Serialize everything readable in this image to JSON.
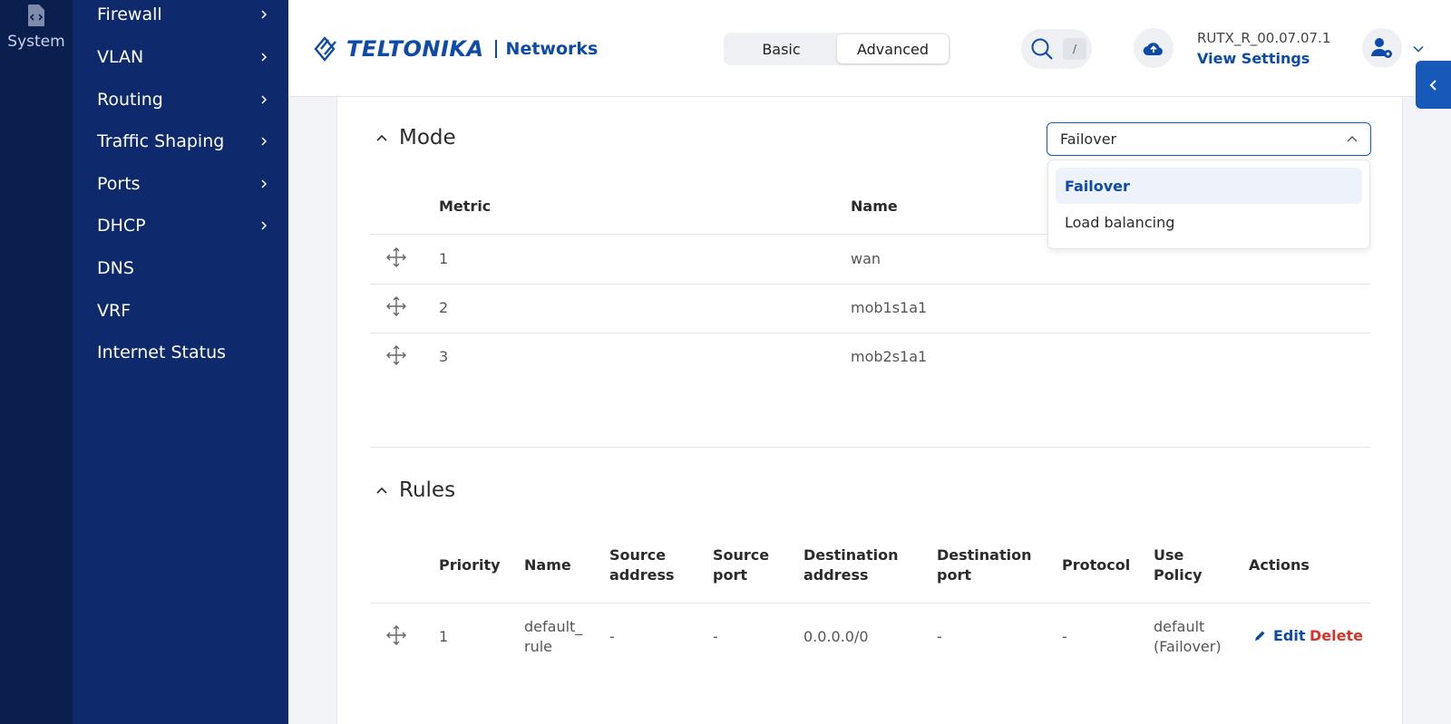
{
  "rail": {
    "label": "System",
    "icon": "system-file-icon"
  },
  "sidebar": {
    "items": [
      {
        "label": "Firewall",
        "has_children": true
      },
      {
        "label": "VLAN",
        "has_children": true
      },
      {
        "label": "Routing",
        "has_children": true
      },
      {
        "label": "Traffic Shaping",
        "has_children": true
      },
      {
        "label": "Ports",
        "has_children": true
      },
      {
        "label": "DHCP",
        "has_children": true
      },
      {
        "label": "DNS",
        "has_children": false
      },
      {
        "label": "VRF",
        "has_children": false
      },
      {
        "label": "Internet Status",
        "has_children": false
      }
    ]
  },
  "header": {
    "logo_text": "TELTONIKA",
    "logo_sub": "Networks",
    "mode_basic": "Basic",
    "mode_advanced": "Advanced",
    "active_mode": "Advanced",
    "search_shortcut": "/",
    "firmware_version": "RUTX_R_00.07.07.1",
    "view_settings": "View Settings"
  },
  "mode_section": {
    "title": "Mode",
    "select_value": "Failover",
    "options": [
      "Failover",
      "Load balancing"
    ],
    "selected_option": "Failover",
    "columns": {
      "metric": "Metric",
      "name": "Name"
    },
    "rows": [
      {
        "metric": "1",
        "name": "wan"
      },
      {
        "metric": "2",
        "name": "mob1s1a1"
      },
      {
        "metric": "3",
        "name": "mob2s1a1"
      }
    ]
  },
  "rules_section": {
    "title": "Rules",
    "columns": {
      "priority": "Priority",
      "name": "Name",
      "source_address": "Source address",
      "source_port": "Source port",
      "destination_address": "Destination address",
      "destination_port": "Destination port",
      "protocol": "Protocol",
      "use_policy": "Use Policy",
      "actions": "Actions"
    },
    "rows": [
      {
        "priority": "1",
        "name": "default_ rule",
        "source_address": "-",
        "source_port": "-",
        "destination_address": "0.0.0.0/0",
        "destination_port": "-",
        "protocol": "-",
        "use_policy": "default (Failover)",
        "edit": "Edit",
        "delete": "Delete"
      }
    ]
  },
  "colors": {
    "rail_bg": "#0b1f4f",
    "sidebar_bg": "#0e2a6d",
    "brand_blue": "#0e4aa8",
    "danger_red": "#d9342b"
  }
}
